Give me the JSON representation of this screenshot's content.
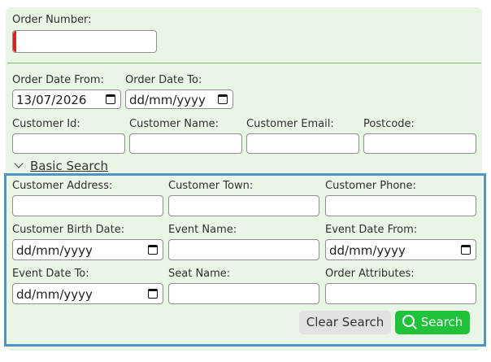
{
  "order_number": {
    "label": "Order Number:",
    "value": ""
  },
  "order_date_from": {
    "label": "Order Date From:",
    "value": "13/07/2026"
  },
  "order_date_to": {
    "label": "Order Date To:",
    "value": "dd/mm/yyyy"
  },
  "customer_id": {
    "label": "Customer Id:",
    "value": ""
  },
  "customer_name": {
    "label": "Customer Name:",
    "value": ""
  },
  "customer_email": {
    "label": "Customer Email:",
    "value": ""
  },
  "postcode": {
    "label": "Postcode:",
    "value": ""
  },
  "basic_search_toggle": {
    "label": "Basic Search"
  },
  "advanced": {
    "customer_address": {
      "label": "Customer Address:",
      "value": ""
    },
    "customer_town": {
      "label": "Customer Town:",
      "value": ""
    },
    "customer_phone": {
      "label": "Customer Phone:",
      "value": ""
    },
    "customer_birth_date": {
      "label": "Customer Birth Date:",
      "value": "dd/mm/yyyy"
    },
    "event_name": {
      "label": "Event Name:",
      "value": ""
    },
    "event_date_from": {
      "label": "Event Date From:",
      "value": "dd/mm/yyyy"
    },
    "event_date_to": {
      "label": "Event Date To:",
      "value": "dd/mm/yyyy"
    },
    "seat_name": {
      "label": "Seat Name:",
      "value": ""
    },
    "order_attributes": {
      "label": "Order Attributes:",
      "value": ""
    }
  },
  "buttons": {
    "clear": "Clear Search",
    "search": "Search"
  },
  "colors": {
    "panel_bg": "#e9f6e6",
    "accent_green": "#1ec33a",
    "focus_blue": "#4b95c8",
    "error_red": "#e0201a"
  }
}
